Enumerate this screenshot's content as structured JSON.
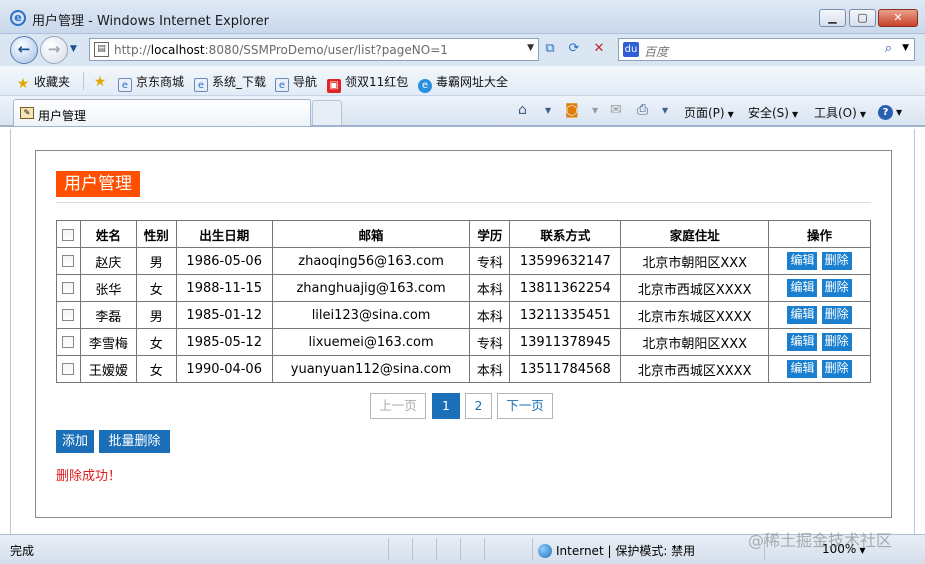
{
  "window": {
    "title": "用户管理 - Windows Internet Explorer",
    "minimize": "▁",
    "maximize": "▢",
    "close": "✕"
  },
  "nav": {
    "url_prefix": "http://",
    "url_host": "localhost",
    "url_rest": ":8080/SSMProDemo/user/list?pageNO=1",
    "search_placeholder": "百度"
  },
  "favorites": {
    "favorites_label": "收藏夹",
    "items": [
      {
        "label": "京东商城",
        "icon": "ie-page-icon"
      },
      {
        "label": "系统_下载",
        "icon": "ie-page-icon"
      },
      {
        "label": "导航",
        "icon": "ie-page-icon"
      },
      {
        "label": "领双11红包",
        "icon": "gift-icon"
      },
      {
        "label": "毒霸网址大全",
        "icon": "ie-icon"
      }
    ]
  },
  "tab": {
    "label": "用户管理"
  },
  "commands": {
    "page": "页面(P)",
    "safety": "安全(S)",
    "tools": "工具(O)"
  },
  "page": {
    "heading": "用户管理",
    "table": {
      "headers": [
        "姓名",
        "性别",
        "出生日期",
        "邮箱",
        "学历",
        "联系方式",
        "家庭住址",
        "操作"
      ],
      "rows": [
        {
          "name": "赵庆",
          "gender": "男",
          "birth": "1986-05-06",
          "email": "zhaoqing56@163.com",
          "edu": "专科",
          "phone": "13599632147",
          "address": "北京市朝阳区XXX"
        },
        {
          "name": "张华",
          "gender": "女",
          "birth": "1988-11-15",
          "email": "zhanghuajig@163.com",
          "edu": "本科",
          "phone": "13811362254",
          "address": "北京市西城区XXXX"
        },
        {
          "name": "李磊",
          "gender": "男",
          "birth": "1985-01-12",
          "email": "lilei123@sina.com",
          "edu": "本科",
          "phone": "13211335451",
          "address": "北京市东城区XXXX"
        },
        {
          "name": "李雪梅",
          "gender": "女",
          "birth": "1985-05-12",
          "email": "lixuemei@163.com",
          "edu": "专科",
          "phone": "13911378945",
          "address": "北京市朝阳区XXX"
        },
        {
          "name": "王嫒嫒",
          "gender": "女",
          "birth": "1990-04-06",
          "email": "yuanyuan112@sina.com",
          "edu": "本科",
          "phone": "13511784568",
          "address": "北京市西城区XXXX"
        }
      ],
      "edit_label": "编辑",
      "delete_label": "删除"
    },
    "pagination": {
      "prev": "上一页",
      "pages": [
        "1",
        "2"
      ],
      "current": "1",
      "next": "下一页"
    },
    "add_label": "添加",
    "batch_delete_label": "批量删除",
    "message": "删除成功！",
    "accent_color": "#ff4f00",
    "button_color": "#1a6fb8"
  },
  "status": {
    "text": "完成",
    "zone": "Internet | 保护模式: 禁用",
    "zoom": "100%",
    "watermark": "@稀土掘金技术社区"
  }
}
